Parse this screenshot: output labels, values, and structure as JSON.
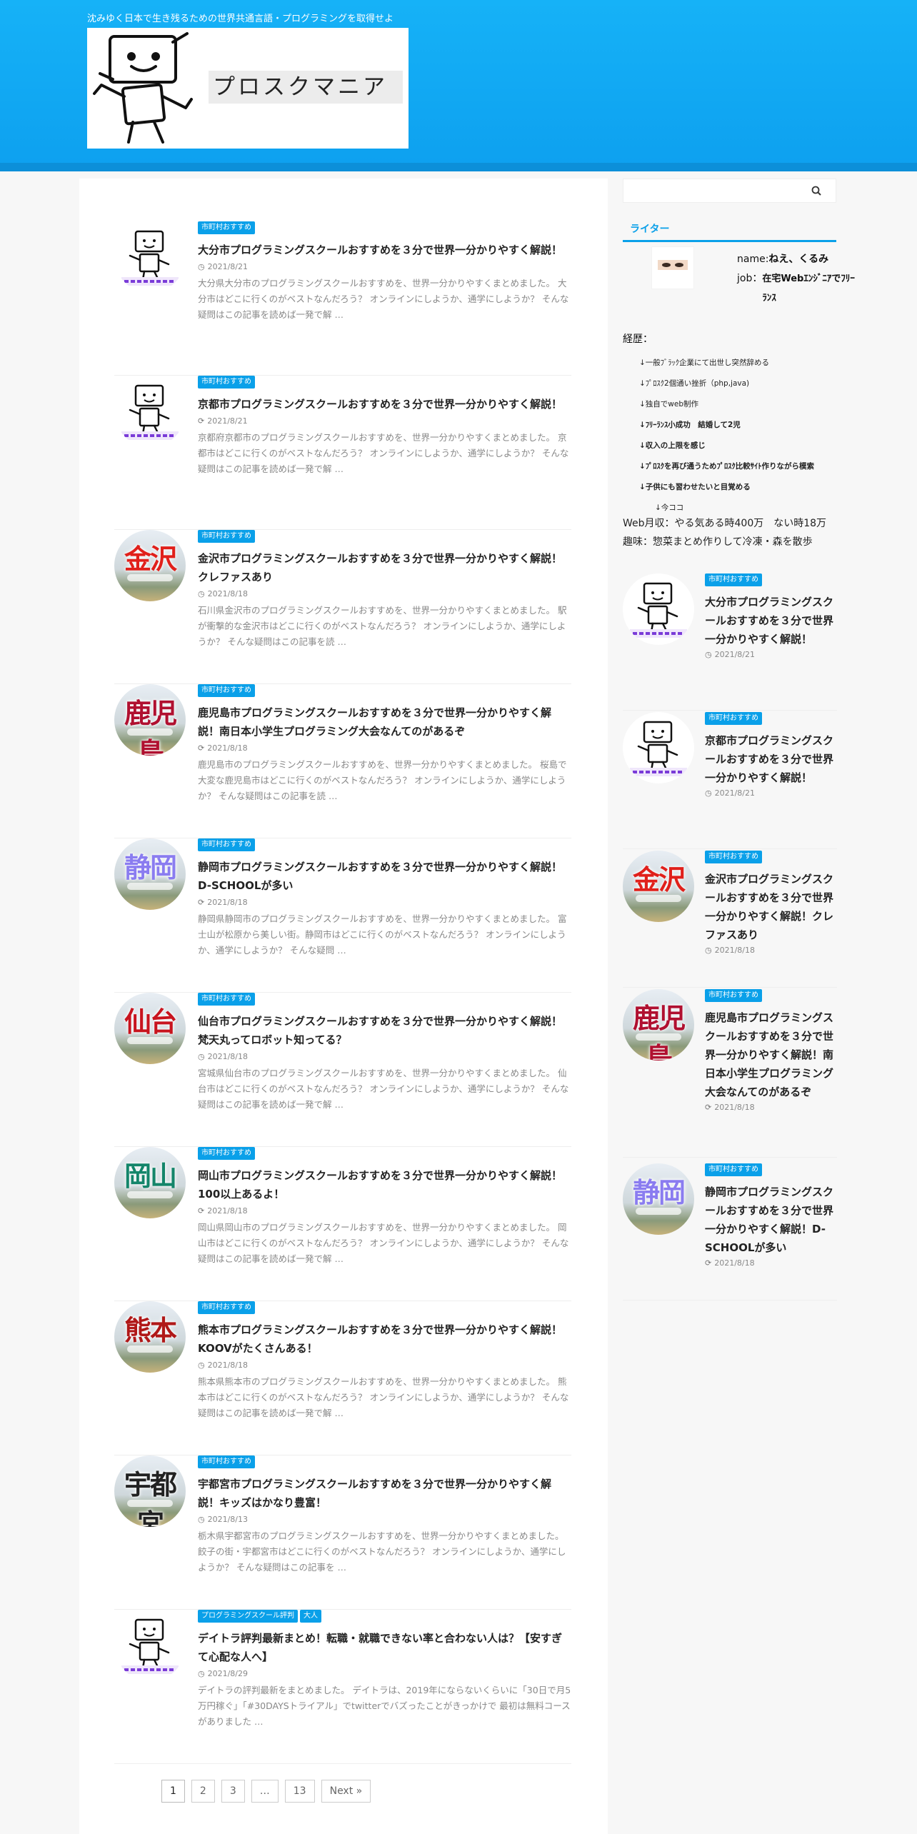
{
  "header": {
    "tagline": "沈みゆく日本で生き残るための世界共通言語・プログラミングを取得せよ",
    "logo_text": "プロスクマニア",
    "brand_color": "#16b2f7"
  },
  "posts": [
    {
      "categories": [
        "市町村おすすめ"
      ],
      "title": "大分市プログラミングスクールおすすめを３分で世界一分かりやすく解説！",
      "date_icon": "clock-icon",
      "date": "2021/8/21",
      "excerpt": "大分県大分市のプログラミングスクールおすすめを、世界一分かりやすくまとめました。 大分市はどこに行くのがベストなんだろう？ オンラインにしようか、通学にしようか？ そんな疑問はこの記事を読めば一発で解 …",
      "thumb": "robot"
    },
    {
      "categories": [
        "市町村おすすめ"
      ],
      "title": "京都市プログラミングスクールおすすめを３分で世界一分かりやすく解説！",
      "date_icon": "refresh-icon",
      "date": "2021/8/21",
      "excerpt": "京都府京都市のプログラミングスクールおすすめを、世界一分かりやすくまとめました。 京都市はどこに行くのがベストなんだろう？ オンラインにしようか、通学にしようか？ そんな疑問はこの記事を読めば一発で解 …",
      "thumb": "robot"
    },
    {
      "categories": [
        "市町村おすすめ"
      ],
      "title": "金沢市プログラミングスクールおすすめを３分で世界一分かりやすく解説！クレファスあり",
      "date_icon": "clock-icon",
      "date": "2021/8/18",
      "excerpt": "石川県金沢市のプログラミングスクールおすすめを、世界一分かりやすくまとめました。 駅が衝撃的な金沢市はどこに行くのがベストなんだろう？ オンラインにしようか、通学にしようか？ そんな疑問はこの記事を読 …",
      "thumb": "city",
      "kanji": "金沢",
      "kanji_color": "#e0201b"
    },
    {
      "categories": [
        "市町村おすすめ"
      ],
      "title": "鹿児島市プログラミングスクールおすすめを３分で世界一分かりやすく解説！南日本小学生プログラミング大会なんてのがあるぞ",
      "date_icon": "refresh-icon",
      "date": "2021/8/18",
      "excerpt": "鹿児島市のプログラミングスクールおすすめを、世界一分かりやすくまとめました。 桜島で大変な鹿児島市はどこに行くのがベストなんだろう？ オンラインにしようか、通学にしようか？ そんな疑問はこの記事を読 …",
      "thumb": "city",
      "kanji": "鹿児島",
      "kanji_color": "#b01030"
    },
    {
      "categories": [
        "市町村おすすめ"
      ],
      "title": "静岡市プログラミングスクールおすすめを３分で世界一分かりやすく解説！D-SCHOOLが多い",
      "date_icon": "refresh-icon",
      "date": "2021/8/18",
      "excerpt": "静岡県静岡市のプログラミングスクールおすすめを、世界一分かりやすくまとめました。 富士山が松原から美しい街。静岡市はどこに行くのがベストなんだろう？ オンラインにしようか、通学にしようか？ そんな疑問 …",
      "thumb": "city",
      "kanji": "静岡",
      "kanji_color": "#8a7cf0"
    },
    {
      "categories": [
        "市町村おすすめ"
      ],
      "title": "仙台市プログラミングスクールおすすめを３分で世界一分かりやすく解説！梵天丸ってロボット知ってる？",
      "date_icon": "clock-icon",
      "date": "2021/8/18",
      "excerpt": "宮城県仙台市のプログラミングスクールおすすめを、世界一分かりやすくまとめました。 仙台市はどこに行くのがベストなんだろう？ オンラインにしようか、通学にしようか？ そんな疑問はこの記事を読めば一発で解 …",
      "thumb": "city",
      "kanji": "仙台",
      "kanji_color": "#c8141e"
    },
    {
      "categories": [
        "市町村おすすめ"
      ],
      "title": "岡山市プログラミングスクールおすすめを３分で世界一分かりやすく解説！100以上あるよ！",
      "date_icon": "refresh-icon",
      "date": "2021/8/18",
      "excerpt": "岡山県岡山市のプログラミングスクールおすすめを、世界一分かりやすくまとめました。 岡山市はどこに行くのがベストなんだろう？ オンラインにしようか、通学にしようか？ そんな疑問はこの記事を読めば一発で解 …",
      "thumb": "city",
      "kanji": "岡山",
      "kanji_color": "#14856a"
    },
    {
      "categories": [
        "市町村おすすめ"
      ],
      "title": "熊本市プログラミングスクールおすすめを３分で世界一分かりやすく解説！KOOVがたくさんある！",
      "date_icon": "clock-icon",
      "date": "2021/8/18",
      "excerpt": "熊本県熊本市のプログラミングスクールおすすめを、世界一分かりやすくまとめました。 熊本市はどこに行くのがベストなんだろう？ オンラインにしようか、通学にしようか？ そんな疑問はこの記事を読めば一発で解 …",
      "thumb": "city",
      "kanji": "熊本",
      "kanji_color": "#b01818"
    },
    {
      "categories": [
        "市町村おすすめ"
      ],
      "title": "宇都宮市プログラミングスクールおすすめを３分で世界一分かりやすく解説！キッズはかなり豊富！",
      "date_icon": "clock-icon",
      "date": "2021/8/13",
      "excerpt": "栃木県宇都宮市のプログラミングスクールおすすめを、世界一分かりやすくまとめました。 餃子の街・宇都宮市はどこに行くのがベストなんだろう？ オンラインにしようか、通学にしようか？ そんな疑問はこの記事を …",
      "thumb": "city",
      "kanji": "宇都宮",
      "kanji_color": "#222222"
    },
    {
      "categories": [
        "プログラミングスクール評判",
        "大人"
      ],
      "title": "デイトラ評判最新まとめ！転職・就職できない率と合わない人は？【安すぎて心配な人へ】",
      "date_icon": "clock-icon",
      "date": "2021/8/29",
      "excerpt": "デイトラの評判最新をまとめました。 デイトラは、2019年にならないくらいに「30日で月5万円稼ぐ」「#30DAYSトライアル」でtwitterでバズったことがきっかけで 最初は無料コースがありました …",
      "thumb": "robot"
    }
  ],
  "pagination": [
    "1",
    "2",
    "3",
    "…",
    "13",
    "Next »"
  ],
  "sidebar": {
    "search_placeholder": "",
    "writer_tab": "ライター",
    "writer_name_label": "name:",
    "writer_name": "ねえ、くるみ",
    "writer_job_label": "job：",
    "writer_job": "在宅Webｴﾝｼﾞﾆｱでﾌﾘｰﾗﾝｽ",
    "career_title": "経歴：",
    "career": [
      {
        "text": "↓一般ﾌﾞﾗｯｸ企業にて出世し突然辞める",
        "bold": false,
        "indent": false
      },
      {
        "text": "↓ﾌﾟﾛｽｸ2個通い挫折（php,java)",
        "bold": false,
        "indent": false
      },
      {
        "text": "↓独自でweb制作",
        "bold": false,
        "indent": false
      },
      {
        "text": "↓ﾌﾘｰﾗﾝｽ小成功　結婚して2児",
        "bold": true,
        "indent": false
      },
      {
        "text": "↓収入の上限を感じ",
        "bold": true,
        "indent": false
      },
      {
        "text": "↓ﾌﾟﾛｽｸを再び通うためﾌﾟﾛｽｸ比較ｻｲﾄ作りながら模索",
        "bold": true,
        "indent": false
      },
      {
        "text": "↓子供にも習わせたいと目覚める",
        "bold": true,
        "indent": false
      },
      {
        "text": "↓今ココ",
        "bold": false,
        "indent": true
      }
    ],
    "income": "Web月収：やる気ある時400万　ない時18万",
    "hobby": "趣味：惣菜まとめ作りして冷凍・森を散歩",
    "recent_posts": [
      {
        "category": "市町村おすすめ",
        "title": "大分市プログラミングスクールおすすめを３分で世界一分かりやすく解説！",
        "date_icon": "clock-icon",
        "date": "2021/8/21",
        "thumb": "robot"
      },
      {
        "category": "市町村おすすめ",
        "title": "京都市プログラミングスクールおすすめを３分で世界一分かりやすく解説！",
        "date_icon": "clock-icon",
        "date": "2021/8/21",
        "thumb": "robot"
      },
      {
        "category": "市町村おすすめ",
        "title": "金沢市プログラミングスクールおすすめを３分で世界一分かりやすく解説！クレファスあり",
        "date_icon": "clock-icon",
        "date": "2021/8/18",
        "thumb": "city",
        "kanji": "金沢",
        "kanji_color": "#e0201b"
      },
      {
        "category": "市町村おすすめ",
        "title": "鹿児島市プログラミングスクールおすすめを３分で世界一分かりやすく解説！南日本小学生プログラミング大会なんてのがあるぞ",
        "date_icon": "refresh-icon",
        "date": "2021/8/18",
        "thumb": "city",
        "kanji": "鹿児島",
        "kanji_color": "#b01030"
      },
      {
        "category": "市町村おすすめ",
        "title": "静岡市プログラミングスクールおすすめを３分で世界一分かりやすく解説！D-SCHOOLが多い",
        "date_icon": "refresh-icon",
        "date": "2021/8/18",
        "thumb": "city",
        "kanji": "静岡",
        "kanji_color": "#8a7cf0"
      }
    ]
  }
}
